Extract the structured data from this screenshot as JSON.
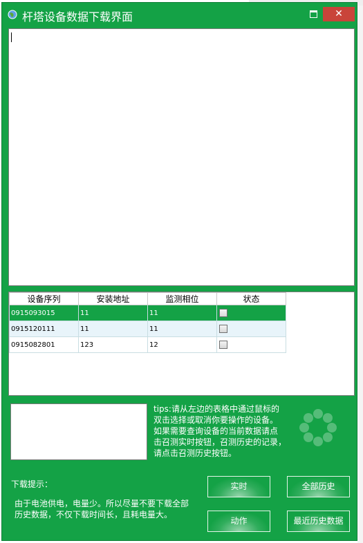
{
  "window": {
    "title": "杆塔设备数据下载界面",
    "maximize_icon": "maximize-icon",
    "close_icon": "close-icon",
    "close_glyph": "✕"
  },
  "grid": {
    "headers": [
      "设备序列",
      "安装地址",
      "监测相位",
      "状态"
    ],
    "rows": [
      {
        "serial": "0915093015",
        "address": "11",
        "phase": "11",
        "status_checked": false,
        "selected": true
      },
      {
        "serial": "0915120111",
        "address": "11",
        "phase": "11",
        "status_checked": false,
        "selected": false
      },
      {
        "serial": "0915082801",
        "address": "123",
        "phase": "12",
        "status_checked": false,
        "selected": false
      }
    ]
  },
  "tips": {
    "lines": [
      "tips:请从左边的表格中通过鼠标的",
      "双击选择或取消你要操作的设备。",
      "如果需要查询设备的当前数据请点",
      "击召测实时按钮，召测历史的记录，",
      "请点击召测历史按钮。"
    ]
  },
  "download": {
    "label": "下载提示：",
    "note_lines": [
      "由于电池供电，电量少。所以尽量不要下载全部",
      "历史数据，不仅下载时间长，且耗电量大。"
    ]
  },
  "buttons": {
    "realtime": "实时",
    "all_history": "全部历史",
    "action": "动作",
    "recent_history": "最近历史数据"
  },
  "colors": {
    "window_green": "#14a246",
    "selected_row": "#14a246",
    "alt_row": "#e8f4fa",
    "close_red": "#c9443a"
  }
}
